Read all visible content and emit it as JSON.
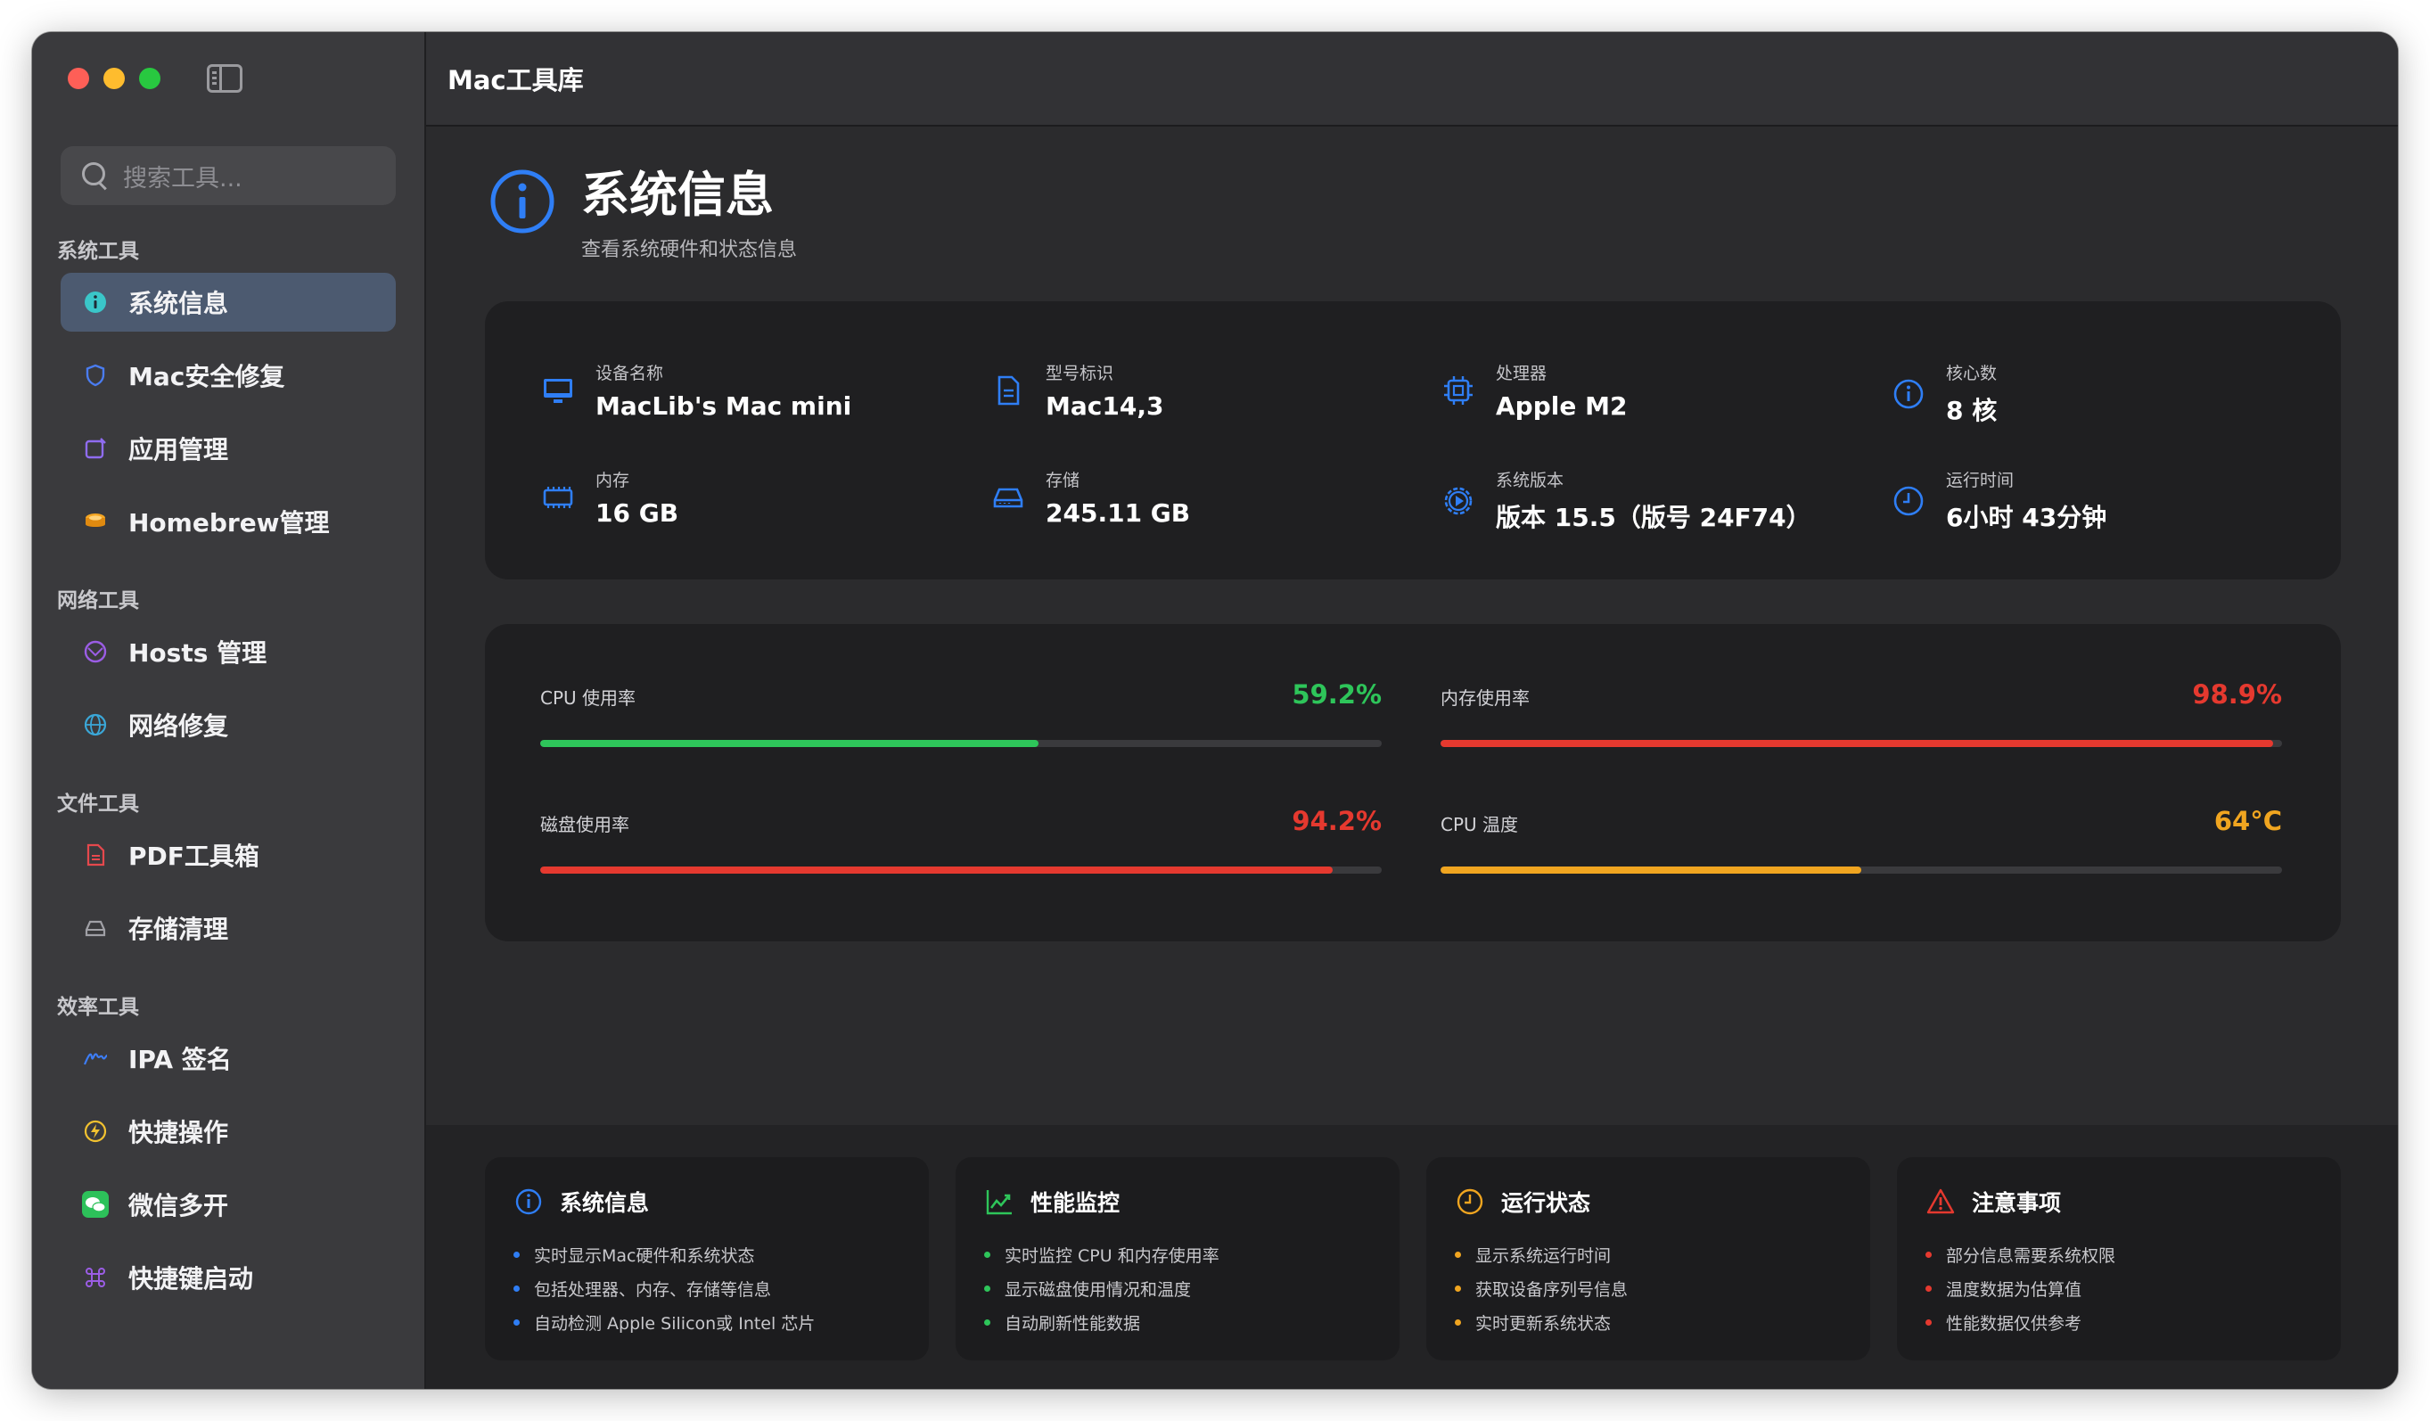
{
  "app": {
    "title": "Mac工具库"
  },
  "colors": {
    "accent": "#2f7ef5",
    "green": "#2ec55a",
    "red": "#e5392f",
    "orange": "#f0a520"
  },
  "search": {
    "placeholder": "搜索工具..."
  },
  "sidebar": {
    "sections": [
      {
        "label": "系统工具",
        "items": [
          {
            "label": "系统信息",
            "icon": "info-circle-icon",
            "active": true
          },
          {
            "label": "Mac安全修复",
            "icon": "shield-icon"
          },
          {
            "label": "应用管理",
            "icon": "app-store-icon"
          },
          {
            "label": "Homebrew管理",
            "icon": "mug-icon"
          }
        ]
      },
      {
        "label": "网络工具",
        "items": [
          {
            "label": "Hosts 管理",
            "icon": "network-icon"
          },
          {
            "label": "网络修复",
            "icon": "globe-icon"
          }
        ]
      },
      {
        "label": "文件工具",
        "items": [
          {
            "label": "PDF工具箱",
            "icon": "pdf-icon"
          },
          {
            "label": "存储清理",
            "icon": "drive-icon"
          }
        ]
      },
      {
        "label": "效率工具",
        "items": [
          {
            "label": "IPA 签名",
            "icon": "signature-icon"
          },
          {
            "label": "快捷操作",
            "icon": "bolt-icon"
          },
          {
            "label": "微信多开",
            "icon": "wechat-icon"
          },
          {
            "label": "快捷键启动",
            "icon": "command-icon"
          }
        ]
      }
    ]
  },
  "page": {
    "title": "系统信息",
    "subtitle": "查看系统硬件和状态信息"
  },
  "info": [
    {
      "label": "设备名称",
      "value": "MacLib's Mac mini",
      "icon": "desktop-icon"
    },
    {
      "label": "型号标识",
      "value": "Mac14,3",
      "icon": "document-icon"
    },
    {
      "label": "处理器",
      "value": "Apple M2",
      "icon": "cpu-icon"
    },
    {
      "label": "核心数",
      "value": "8 核",
      "icon": "info-circle-icon"
    },
    {
      "label": "内存",
      "value": "16 GB",
      "icon": "memory-icon"
    },
    {
      "label": "存储",
      "value": "245.11 GB",
      "icon": "drive-icon"
    },
    {
      "label": "系统版本",
      "value": "版本 15.5（版号 24F74）",
      "icon": "gear-play-icon"
    },
    {
      "label": "运行时间",
      "value": "6小时 43分钟",
      "icon": "clock-icon"
    }
  ],
  "metrics": [
    {
      "label": "CPU 使用率",
      "value": "59.2%",
      "level": 0.592,
      "color": "#2ec55a"
    },
    {
      "label": "内存使用率",
      "value": "98.9%",
      "level": 0.989,
      "color": "#e5392f"
    },
    {
      "label": "磁盘使用率",
      "value": "94.2%",
      "level": 0.942,
      "color": "#e5392f"
    },
    {
      "label": "CPU 温度",
      "value": "64°C",
      "level": 0.5,
      "color": "#f0a520"
    }
  ],
  "tips": [
    {
      "title": "系统信息",
      "icon": "info-circle-icon",
      "color": "#2f7ef5",
      "items": [
        "实时显示Mac硬件和系统状态",
        "包括处理器、内存、存储等信息",
        "自动检测 Apple Silicon或 Intel 芯片"
      ]
    },
    {
      "title": "性能监控",
      "icon": "chart-icon",
      "color": "#2ec55a",
      "items": [
        "实时监控 CPU 和内存使用率",
        "显示磁盘使用情况和温度",
        "自动刷新性能数据"
      ]
    },
    {
      "title": "运行状态",
      "icon": "clock-icon",
      "color": "#f0a520",
      "items": [
        "显示系统运行时间",
        "获取设备序列号信息",
        "实时更新系统状态"
      ]
    },
    {
      "title": "注意事项",
      "icon": "warning-icon",
      "color": "#e5392f",
      "items": [
        "部分信息需要系统权限",
        "温度数据为估算值",
        "性能数据仅供参考"
      ]
    }
  ]
}
